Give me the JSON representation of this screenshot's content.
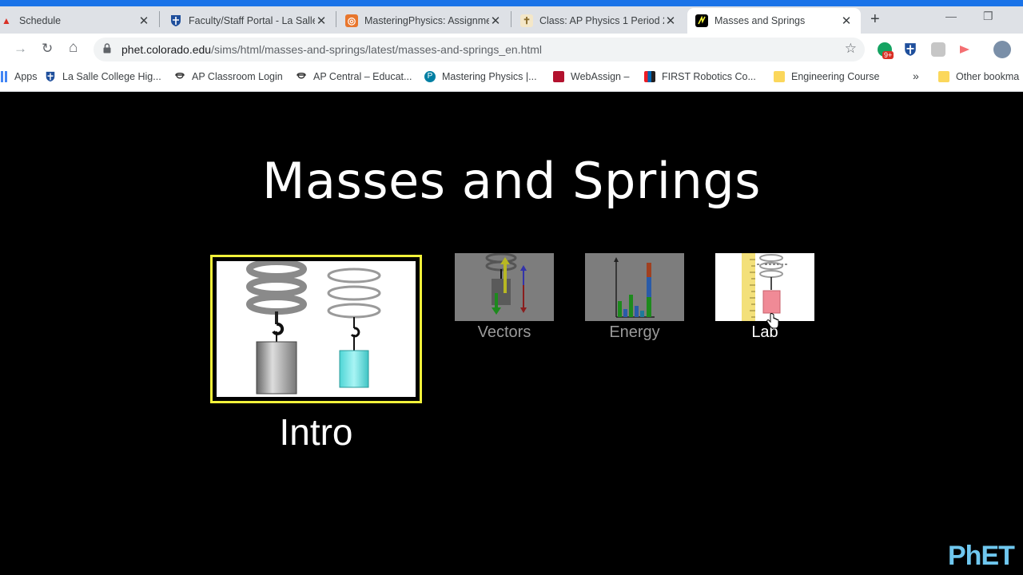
{
  "tabs": [
    {
      "title": "Schedule",
      "close": "✕"
    },
    {
      "title": "Faculty/Staff Portal - La Salle",
      "close": "✕"
    },
    {
      "title": "MasteringPhysics: Assignme",
      "close": "✕"
    },
    {
      "title": "Class: AP Physics 1 Period 2",
      "close": "✕"
    },
    {
      "title": "Masses and Springs",
      "close": "✕"
    }
  ],
  "new_tab": "+",
  "window": {
    "minimize": "—",
    "restore": "❐"
  },
  "nav": {
    "back": "→",
    "reload": "↻",
    "home": "⌂"
  },
  "address": {
    "host": "phet.colorado.edu",
    "path": "/sims/html/masses-and-springs/latest/masses-and-springs_en.html",
    "star": "☆"
  },
  "extensions": {
    "badge": "9+"
  },
  "bookmarks": [
    {
      "label": "Apps",
      "icon": "apps-grid-icon"
    },
    {
      "label": "La Salle College Hig...",
      "icon": "lasalle-shield-icon"
    },
    {
      "label": "AP Classroom Login",
      "icon": "ap-acorn-icon"
    },
    {
      "label": "AP Central – Educat...",
      "icon": "ap-acorn-icon"
    },
    {
      "label": "Mastering Physics |...",
      "icon": "pearson-icon"
    },
    {
      "label": "WebAssign –",
      "icon": "webassign-icon"
    },
    {
      "label": "FIRST Robotics Co...",
      "icon": "first-robotics-icon"
    },
    {
      "label": "Engineering Course",
      "icon": "folder-icon"
    }
  ],
  "bookmarks_more": "»",
  "other_bookmarks": "Other bookma",
  "sim": {
    "title": "Masses and Springs",
    "screens": [
      {
        "label": "Intro",
        "selected": true
      },
      {
        "label": "Vectors",
        "selected": false
      },
      {
        "label": "Energy",
        "selected": false
      },
      {
        "label": "Lab",
        "selected": false
      }
    ],
    "logo": "PhET"
  },
  "colors": {
    "selection": "#f2f23a",
    "phet_logo": "#6fc7ef",
    "tab_bar": "#dee1e6"
  }
}
